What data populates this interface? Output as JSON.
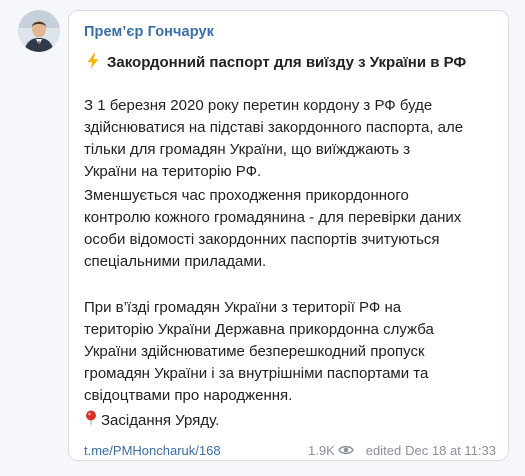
{
  "post": {
    "author": "Прем’єр Гончарук",
    "headline": "Закордонний паспорт для виїзду з України в РФ",
    "paragraphs": [
      {
        "lines": [
          "З 1 березня 2020 року перетин кордону з РФ буде",
          "здійснюватися на підставі закордонного паспорта, але",
          "тільки для громадян України, що виїжджають з",
          "України на територію РФ."
        ]
      },
      {
        "lines": [
          "Зменшується час проходження прикордонного",
          "контролю кожного громадянина - для перевірки даних",
          "особи відомості закордонних паспортів зчитуються",
          "спеціальними приладами."
        ]
      },
      {
        "lines": [
          "При в’їзді громадян України з території РФ на",
          "територію України Державна прикордонна служба",
          "України здійснюватиме безперешкодний пропуск",
          "громадян України і за внутрішніми паспортами та",
          "свідоцтвами про народження."
        ]
      }
    ],
    "signature": "Засідання Уряду."
  },
  "footer": {
    "link": "t.me/PMHoncharuk/168",
    "views": "1.9K",
    "edited": "edited",
    "date": "Dec 18 at 11:33"
  },
  "icons": {
    "headline": "lightning-icon",
    "signature": "pushpin-icon",
    "views": "eye-icon"
  },
  "colors": {
    "background": "#f6f7fa",
    "bubble": "#ffffff",
    "author": "#3a6ea5",
    "link": "#3a6ea5",
    "text": "#222222",
    "meta": "#8a9099",
    "bolt": "#f4b400",
    "pin": "#d93025"
  }
}
